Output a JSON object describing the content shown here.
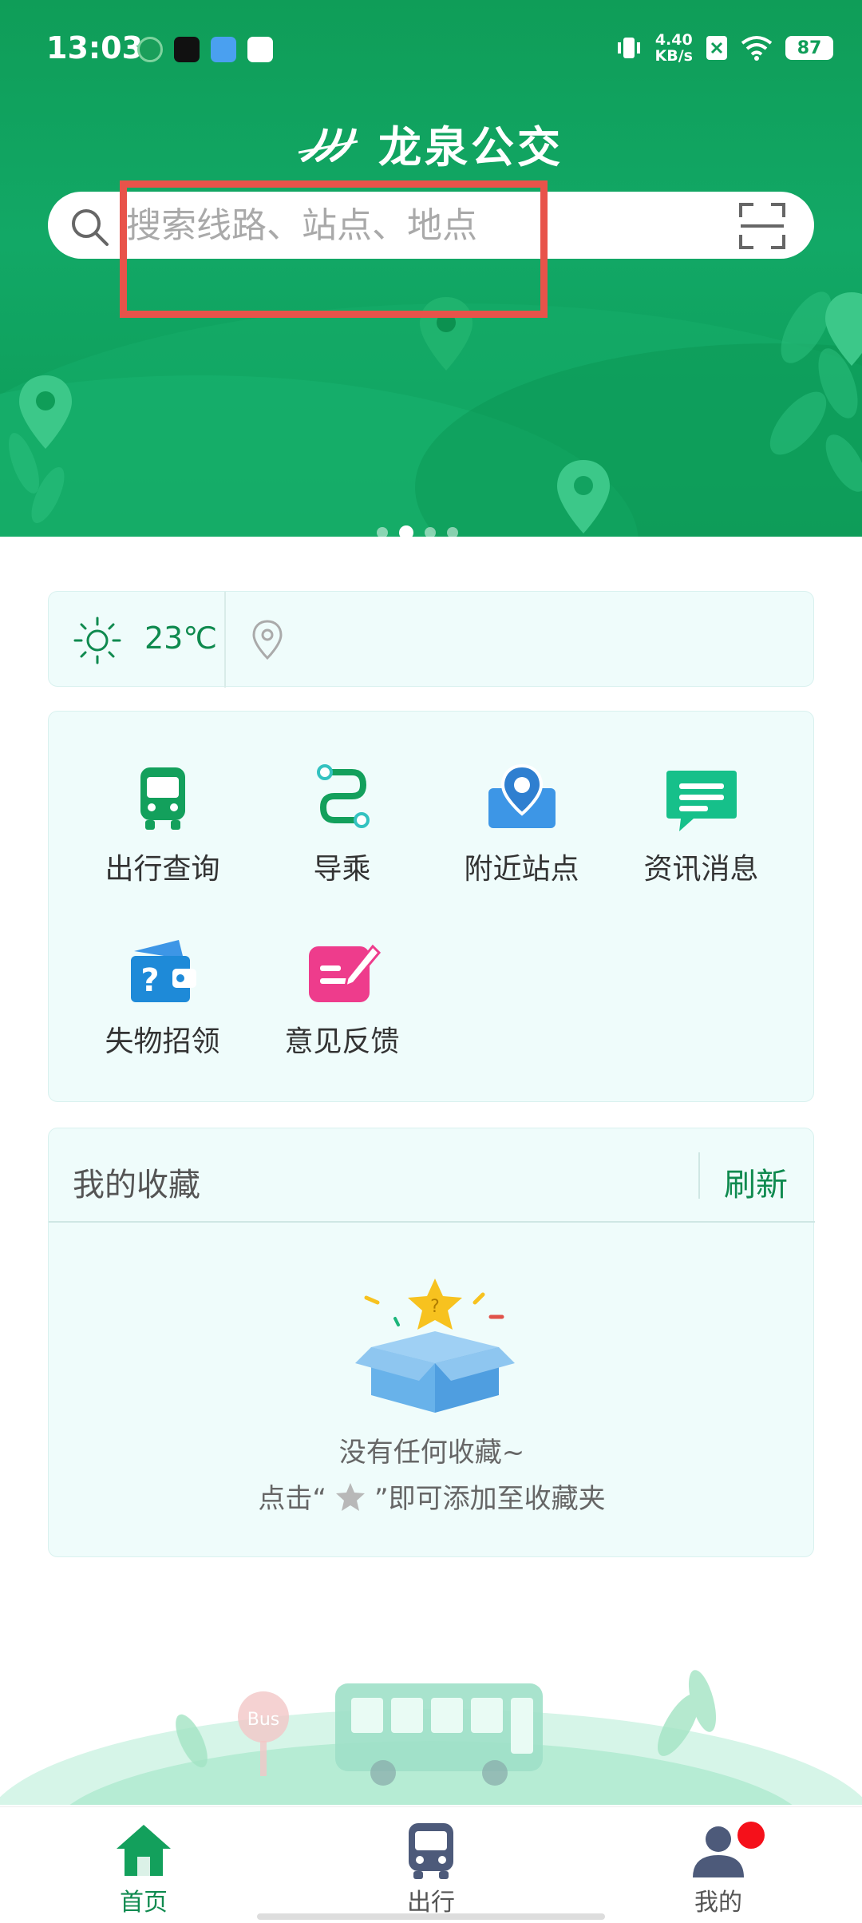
{
  "status_bar": {
    "time": "13:03",
    "network_speed_value": "4.40",
    "network_speed_unit": "KB/s",
    "battery": "87"
  },
  "app": {
    "title": "龙泉公交",
    "brand_color": "#0f9d58"
  },
  "search": {
    "placeholder": "搜索线路、站点、地点",
    "value": ""
  },
  "weather": {
    "temperature": "23℃"
  },
  "quick_menu": [
    {
      "label": "出行查询",
      "icon": "bus-icon"
    },
    {
      "label": "导乘",
      "icon": "route-icon"
    },
    {
      "label": "附近站点",
      "icon": "nearby-stop-icon"
    },
    {
      "label": "资讯消息",
      "icon": "message-icon"
    },
    {
      "label": "失物招领",
      "icon": "lost-found-icon"
    },
    {
      "label": "意见反馈",
      "icon": "feedback-icon"
    }
  ],
  "favorites": {
    "title": "我的收藏",
    "refresh_label": "刷新",
    "empty_line1": "没有任何收藏~",
    "empty_line2_prefix": "点击“",
    "empty_line2_suffix": "”即可添加至收藏夹"
  },
  "illustration": {
    "stop_sign_text": "Bus"
  },
  "tab_bar": [
    {
      "label": "首页",
      "icon": "home-icon",
      "active": true
    },
    {
      "label": "出行",
      "icon": "bus-icon",
      "active": false
    },
    {
      "label": "我的",
      "icon": "profile-icon",
      "active": false
    }
  ]
}
